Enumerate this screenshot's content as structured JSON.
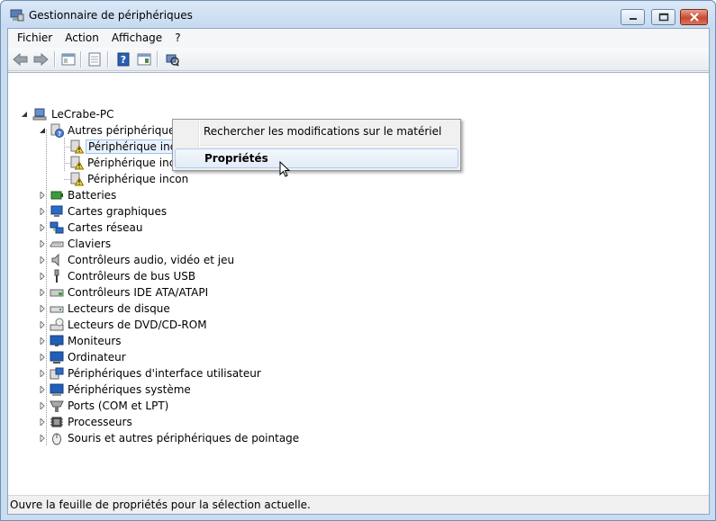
{
  "window": {
    "title": "Gestionnaire de périphériques"
  },
  "menu": [
    "Fichier",
    "Action",
    "Affichage",
    "?"
  ],
  "toolbar": {
    "buttons": [
      "back-icon",
      "forward-icon",
      "show-hide-console-tree-icon",
      "properties-icon",
      "help-icon",
      "view-icon",
      "scan-hardware-icon"
    ]
  },
  "tree": {
    "root": "LeCrabe-PC",
    "other_devices": {
      "label": "Autres périphériques",
      "children": [
        "Périphérique inconnu",
        "Périphérique inconnu",
        "Périphérique inconnu"
      ],
      "children_visible": [
        "Périphérique inconnu",
        "Périphérique incon",
        "Périphérique incon"
      ]
    },
    "categories": [
      "Batteries",
      "Cartes graphiques",
      "Cartes réseau",
      "Claviers",
      "Contrôleurs audio, vidéo et jeu",
      "Contrôleurs de bus USB",
      "Contrôleurs IDE ATA/ATAPI",
      "Lecteurs de disque",
      "Lecteurs de DVD/CD-ROM",
      "Moniteurs",
      "Ordinateur",
      "Périphériques d'interface utilisateur",
      "Périphériques système",
      "Ports (COM et LPT)",
      "Processeurs",
      "Souris et autres périphériques de pointage"
    ]
  },
  "context_menu": {
    "items": [
      "Rechercher les modifications sur le matériel",
      "Propriétés"
    ]
  },
  "status": "Ouvre la feuille de propriétés pour la sélection actuelle."
}
